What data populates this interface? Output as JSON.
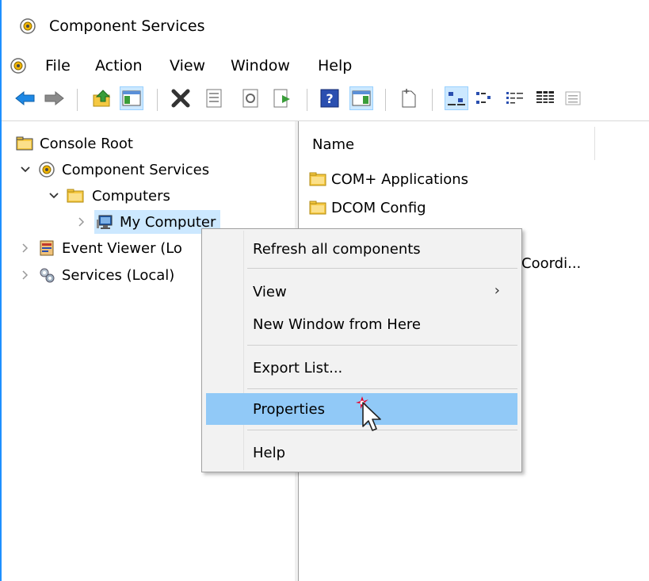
{
  "window": {
    "title": "Component Services"
  },
  "menu": {
    "items": [
      "File",
      "Action",
      "View",
      "Window",
      "Help"
    ]
  },
  "toolbar": {
    "buttons": [
      "back-icon",
      "forward-icon",
      "up-folder-icon",
      "show-hide-tree-icon",
      "delete-icon",
      "properties-icon",
      "refresh-icon",
      "export-list-icon",
      "help-icon",
      "show-hide-action-pane-icon",
      "new-window-icon",
      "large-icons-view-icon",
      "small-icons-view-icon",
      "list-view-icon",
      "detail-view-icon",
      "extra-view-icon"
    ]
  },
  "tree": {
    "items": [
      {
        "label": "Console Root"
      },
      {
        "label": "Component Services"
      },
      {
        "label": "Computers"
      },
      {
        "label": "My Computer"
      },
      {
        "label": "Event Viewer (Lo"
      },
      {
        "label": "Services (Local)"
      }
    ]
  },
  "list": {
    "column_name": "Name",
    "items": [
      {
        "label": "COM+ Applications"
      },
      {
        "label": "DCOM Config"
      },
      {
        "label": "Coordi..."
      }
    ]
  },
  "context_menu": {
    "items": [
      {
        "label": "Refresh all components"
      },
      {
        "label": "View",
        "submenu_arrow": "›"
      },
      {
        "label": "New Window from Here"
      },
      {
        "label": "Export List..."
      },
      {
        "label": "Properties",
        "highlighted": true
      },
      {
        "label": "Help"
      }
    ]
  },
  "colors": {
    "selection": "#cce8ff",
    "menu_hover": "#91c9f7",
    "window_border": "#1e90ff"
  }
}
